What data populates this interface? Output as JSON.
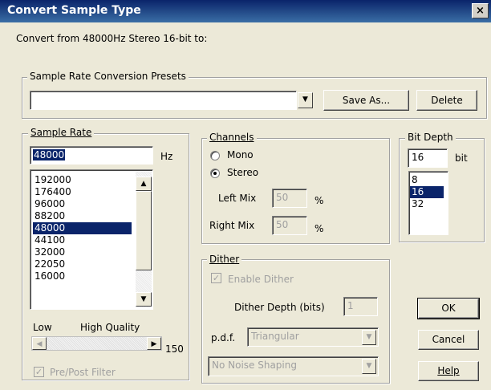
{
  "window": {
    "title": "Convert Sample Type",
    "close_glyph": "×"
  },
  "convert_from": "Convert from 48000Hz Stereo 16-bit to:",
  "presets": {
    "label": "Sample Rate Conversion Presets",
    "value": "",
    "save_as": "Save As...",
    "delete": "Delete"
  },
  "sample_rate": {
    "label": "Sample Rate",
    "value": "48000",
    "unit": "Hz",
    "options": [
      "192000",
      "176400",
      "96000",
      "88200",
      "48000",
      "44100",
      "32000",
      "22050",
      "16000"
    ],
    "selected": "48000",
    "low": "Low",
    "high": "High Quality",
    "quality": "150",
    "prepost": "Pre/Post Filter"
  },
  "channels": {
    "label": "Channels",
    "mono": "Mono",
    "stereo": "Stereo",
    "selected": "Stereo",
    "left_mix": "Left Mix",
    "left_value": "50",
    "right_mix": "Right Mix",
    "right_value": "50",
    "percent": "%"
  },
  "bit_depth": {
    "label": "Bit Depth",
    "value": "16",
    "unit": "bit",
    "options": [
      "8",
      "16",
      "32"
    ],
    "selected": "16"
  },
  "dither": {
    "label": "Dither",
    "enable": "Enable Dither",
    "depth_label": "Dither Depth (bits)",
    "depth_value": "1",
    "pdf_label": "p.d.f.",
    "pdf_value": "Triangular",
    "shaping_value": "No Noise Shaping"
  },
  "buttons": {
    "ok": "OK",
    "cancel": "Cancel",
    "help": "Help"
  },
  "colors": {
    "title_bar": "#0a246a",
    "face": "#ece9d8",
    "selection": "#0a246a"
  }
}
